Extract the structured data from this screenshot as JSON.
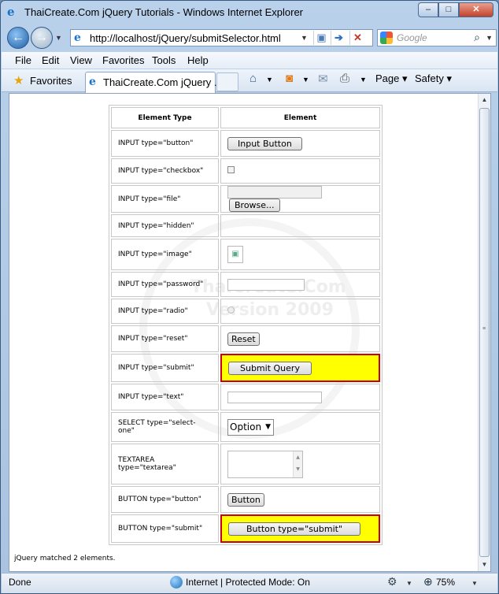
{
  "window": {
    "title": "ThaiCreate.Com jQuery Tutorials - Windows Internet Explorer",
    "controls": {
      "minimize": "–",
      "maximize": "□",
      "close": "✕"
    }
  },
  "address": {
    "url": "http://localhost/jQuery/submitSelector.html",
    "search_placeholder": "Google"
  },
  "menu": [
    "File",
    "Edit",
    "View",
    "Favorites",
    "Tools",
    "Help"
  ],
  "favorites_label": "Favorites",
  "tab_title": "ThaiCreate.Com jQuery ...",
  "commands": {
    "page": "Page",
    "safety": "Safety"
  },
  "table": {
    "headers": [
      "Element Type",
      "Element"
    ],
    "rows": [
      {
        "type": "INPUT type=\"button\"",
        "control": "button",
        "value": "Input Button"
      },
      {
        "type": "INPUT type=\"checkbox\"",
        "control": "checkbox"
      },
      {
        "type": "INPUT type=\"file\"",
        "control": "file",
        "value": "Browse..."
      },
      {
        "type": "INPUT type=\"hidden\"",
        "control": "hidden"
      },
      {
        "type": "INPUT type=\"image\"",
        "control": "image"
      },
      {
        "type": "INPUT type=\"password\"",
        "control": "password"
      },
      {
        "type": "INPUT type=\"radio\"",
        "control": "radio"
      },
      {
        "type": "INPUT type=\"reset\"",
        "control": "reset",
        "value": "Reset"
      },
      {
        "type": "INPUT type=\"submit\"",
        "control": "submit",
        "value": "Submit Query",
        "highlighted": true
      },
      {
        "type": "INPUT type=\"text\"",
        "control": "text"
      },
      {
        "type": "SELECT type=\"select-one\"",
        "control": "select",
        "value": "Option"
      },
      {
        "type": "TEXTAREA type=\"textarea\"",
        "control": "textarea"
      },
      {
        "type": "BUTTON type=\"button\"",
        "control": "button-el",
        "value": "Button"
      },
      {
        "type": "BUTTON type=\"submit\"",
        "control": "submit-el",
        "value": "Button type=\"submit\"",
        "highlighted": true
      }
    ]
  },
  "result_text": "jQuery matched 2 elements.",
  "watermark": {
    "line1": "ThaiCreate.Com",
    "line2": "Version 2009"
  },
  "statusbar": {
    "left": "Done",
    "zone": "Internet | Protected Mode: On",
    "zoom": "75%"
  },
  "colors": {
    "highlight_bg": "#ffff00",
    "highlight_border": "#cc0000"
  }
}
